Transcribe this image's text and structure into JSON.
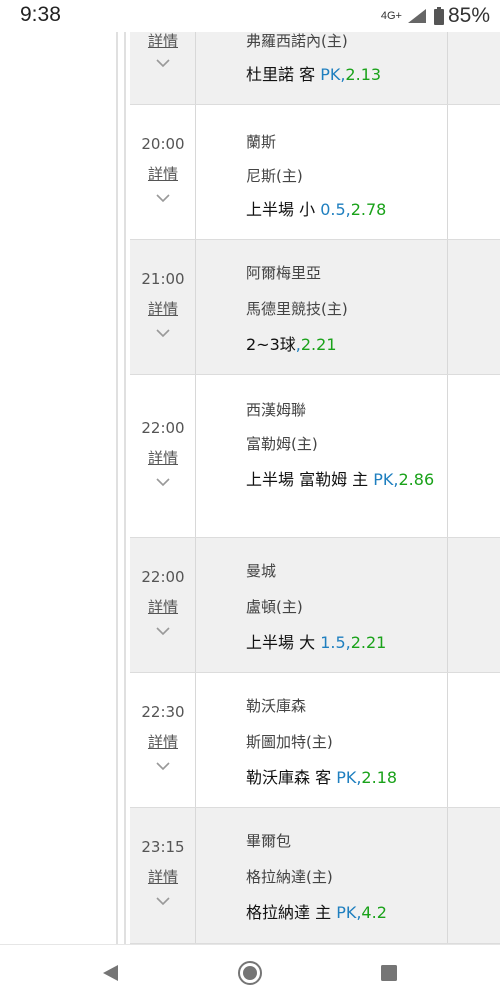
{
  "status_bar": {
    "time": "9:38",
    "network": "4G+",
    "battery": "85%"
  },
  "matches": [
    {
      "time": "",
      "detail": "詳情",
      "away": "",
      "home": "弗羅西諾內(主)",
      "bet_text": "杜里諾 客 ",
      "handicap": "PK",
      "sep": ",",
      "odds": "2.13"
    },
    {
      "time": "20:00",
      "detail": "詳情",
      "away": "蘭斯",
      "home": "尼斯(主)",
      "bet_text": "上半場 小 ",
      "handicap": "0.5",
      "sep": ",",
      "odds": "2.78"
    },
    {
      "time": "21:00",
      "detail": "詳情",
      "away": "阿爾梅里亞",
      "home": "馬德里競技(主)",
      "bet_text": "2~3球",
      "handicap": "",
      "sep": ",",
      "odds": "2.21"
    },
    {
      "time": "22:00",
      "detail": "詳情",
      "away": "西漢姆聯",
      "home": "富勒姆(主)",
      "bet_text": "上半場 富勒姆 主 ",
      "handicap": "PK",
      "sep": ",",
      "odds": "2.86"
    },
    {
      "time": "22:00",
      "detail": "詳情",
      "away": "曼城",
      "home": "盧頓(主)",
      "bet_text": "上半場 大 ",
      "handicap": "1.5",
      "sep": ",",
      "odds": "2.21"
    },
    {
      "time": "22:30",
      "detail": "詳情",
      "away": "勒沃庫森",
      "home": "斯圖加特(主)",
      "bet_text": "勒沃庫森 客 ",
      "handicap": "PK",
      "sep": ",",
      "odds": "2.18"
    },
    {
      "time": "23:15",
      "detail": "詳情",
      "away": "畢爾包",
      "home": "格拉納達(主)",
      "bet_text": "格拉納達 主 ",
      "handicap": "PK",
      "sep": ",",
      "odds": "4.2"
    }
  ],
  "colors": {
    "handicap": "#1f7fbf",
    "odds": "#1aa21a",
    "shaded_row": "#f0f0f0"
  },
  "nav": {
    "back_icon": "back-triangle-icon",
    "home_icon": "home-circle-icon",
    "recent_icon": "recents-square-icon"
  }
}
